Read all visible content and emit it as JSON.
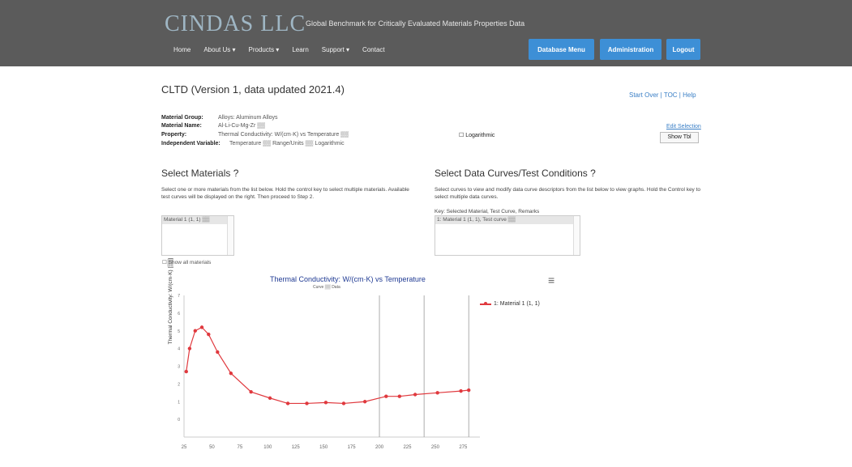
{
  "header": {
    "logo": "CINDAS LLC",
    "tagline": "Global Benchmark for Critically Evaluated Materials Properties Data",
    "nav": [
      "Home",
      "About Us ▾",
      "Products ▾",
      "Learn",
      "Support ▾",
      "Contact"
    ],
    "buttons": [
      "Database Menu",
      "Administration",
      "Logout"
    ]
  },
  "page": {
    "title": "CLTD (Version 1, data updated 2021.4)",
    "top_links": "Start Over | TOC | Help",
    "meta": [
      {
        "key": "Material Group:",
        "value": "Alloys: Aluminum Alloys"
      },
      {
        "key": "Material Name:",
        "value": "Al-Li-Cu-Mg-Zr ▒▒"
      },
      {
        "key": "Property:",
        "value": "Thermal Conductivity: W/(cm·K) vs Temperature ▒▒"
      },
      {
        "key": "Independent Variable:",
        "value": "Temperature ▒▒  Range/Units ▒▒  Logarithmic"
      }
    ],
    "property_extra": "Logarithmic",
    "right_link": "Edit Selection",
    "show_button": "Show Tbl"
  },
  "materials": {
    "title": "Select Materials ?",
    "text": "Select one or more materials from the list below. Hold the control key to select multiple materials. Available test curves will be displayed on the right. Then proceed to Step 2.",
    "items": [
      "Material 1 (1, 1) ▒▒"
    ],
    "show_link": "Show all materials"
  },
  "curves": {
    "title": "Select Data Curves/Test Conditions ?",
    "text": "Select curves to view and modify data curve descriptors from the list below to view graphs. Hold the Control key to select multiple data curves.",
    "key_text": "Key: Selected Material, Test Curve, Remarks",
    "items": [
      "1: Material 1 (1, 1), Test curve ▒▒"
    ]
  },
  "chart_data": {
    "type": "line",
    "title": "Thermal Conductivity: W/(cm·K) vs Temperature",
    "subtitle": "Curve ▒▒ Data",
    "ylabel": "Thermal Conductivity: W/(cm·K) [▒▒]",
    "xlabel": "",
    "legend": "1: Material 1 (1, 1)",
    "legend_position": "right",
    "x_ticks": [
      "25",
      "50",
      "75",
      "100",
      "125",
      "150",
      "175",
      "200",
      "225",
      "250",
      "275"
    ],
    "y_ticks": [
      "0",
      "1",
      "2",
      "3",
      "4",
      "5",
      "6",
      "7"
    ],
    "grid": false,
    "series": [
      {
        "name": "1: Material 1 (1, 1)",
        "color": "#e0393e",
        "x": [
          27,
          30,
          35,
          41,
          47,
          55,
          67,
          85,
          102,
          118,
          135,
          152,
          168,
          187,
          206,
          218,
          232,
          252,
          273,
          280
        ],
        "y": [
          2.7,
          4.0,
          5.0,
          5.2,
          4.8,
          3.8,
          2.6,
          1.55,
          1.2,
          0.9,
          0.9,
          0.95,
          0.9,
          1.0,
          1.3,
          1.3,
          1.4,
          1.5,
          1.6,
          1.65
        ]
      }
    ],
    "vlines_x": [
      200,
      240,
      280
    ],
    "xlim": [
      25,
      290
    ],
    "ylim": [
      -1,
      7
    ]
  }
}
